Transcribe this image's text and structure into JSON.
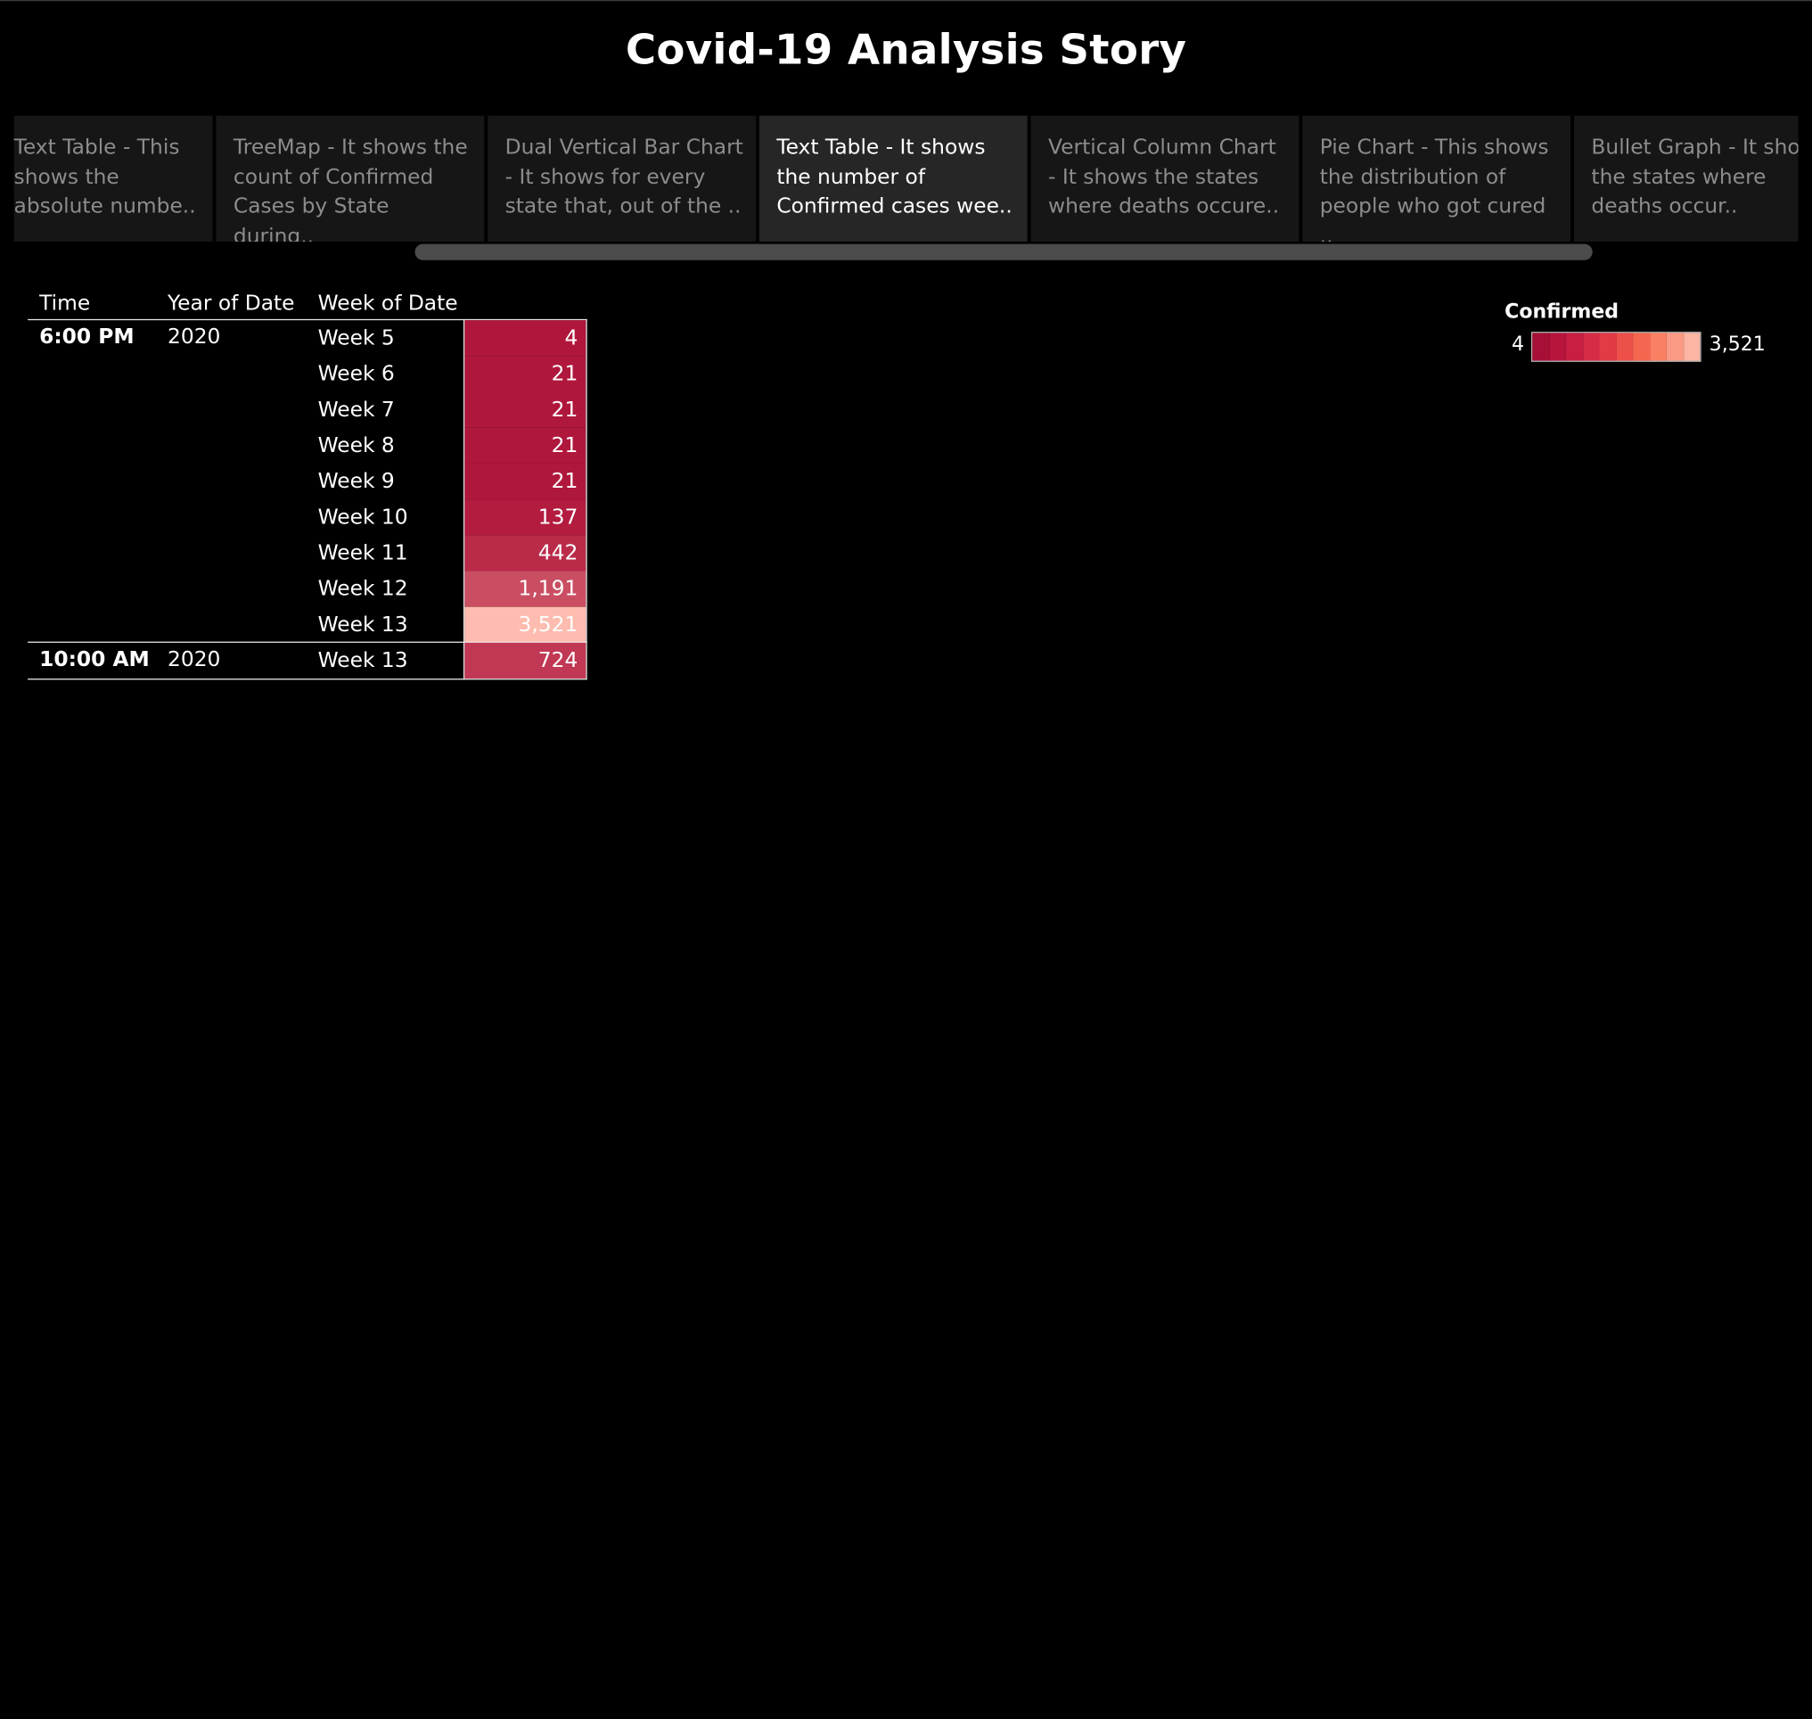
{
  "story": {
    "title": "Covid-19 Analysis Story"
  },
  "nav": {
    "active_index": 3,
    "points": [
      {
        "label": "Text Table - This shows the absolute numbe.."
      },
      {
        "label": "TreeMap - It shows the count of Confirmed Cases by State during.."
      },
      {
        "label": "Dual Vertical Bar Chart - It shows for every state that, out of the .."
      },
      {
        "label": "Text Table - It shows the number of Confirmed cases wee.."
      },
      {
        "label": "Vertical Column Chart - It shows the states where deaths occure.."
      },
      {
        "label": "Pie Chart - This shows the distribution of people who got cured .."
      },
      {
        "label": "Bullet Graph - It shows the states where deaths occur.."
      }
    ]
  },
  "table": {
    "headers": {
      "time": "Time",
      "year": "Year of Date",
      "week": "Week of Date"
    },
    "groups": [
      {
        "time": "6:00 PM",
        "year": "2020",
        "rows": [
          {
            "week": "Week 5",
            "value": 4,
            "display": "4"
          },
          {
            "week": "Week 6",
            "value": 21,
            "display": "21"
          },
          {
            "week": "Week 7",
            "value": 21,
            "display": "21"
          },
          {
            "week": "Week 8",
            "value": 21,
            "display": "21"
          },
          {
            "week": "Week 9",
            "value": 21,
            "display": "21"
          },
          {
            "week": "Week 10",
            "value": 137,
            "display": "137"
          },
          {
            "week": "Week 11",
            "value": 442,
            "display": "442"
          },
          {
            "week": "Week 12",
            "value": 1191,
            "display": "1,191"
          },
          {
            "week": "Week 13",
            "value": 3521,
            "display": "3,521"
          }
        ]
      },
      {
        "time": "10:00 AM",
        "year": "2020",
        "rows": [
          {
            "week": "Week 13",
            "value": 724,
            "display": "724"
          }
        ]
      }
    ]
  },
  "legend": {
    "title": "Confirmed",
    "min_label": "4",
    "max_label": "3,521",
    "min": 4,
    "max": 3521
  },
  "colors": {
    "background": "#000000",
    "scale_low": "#b0163b",
    "scale_high": "#fdbcaf",
    "legend_steps": [
      "#a80f37",
      "#b8153d",
      "#c71e42",
      "#d62c45",
      "#e23b45",
      "#ec5048",
      "#f56650",
      "#fa8064",
      "#fb9a84",
      "#fcb4a3"
    ]
  }
}
